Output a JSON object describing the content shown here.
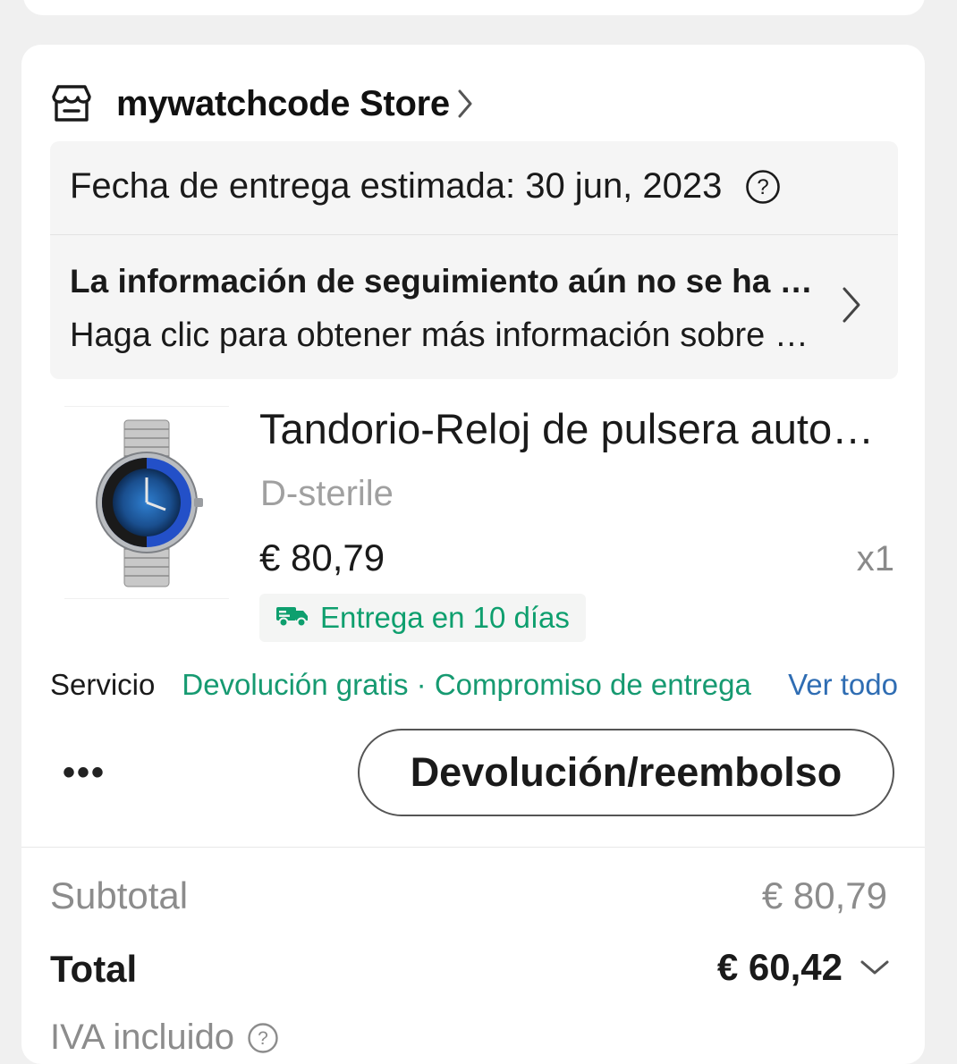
{
  "store": {
    "name": "mywatchcode Store",
    "icon": "store-icon"
  },
  "delivery": {
    "estimated_date": "Fecha de entrega estimada: 30 jun, 2023",
    "tracking_title": "La información de seguimiento aún no se ha actualizado",
    "tracking_subtitle": "Haga clic para obtener más información sobre el envío"
  },
  "product": {
    "title": "Tandorio-Reloj de pulsera automático",
    "variant": "D-sterile",
    "price": "€ 80,79",
    "quantity": "x1",
    "delivery_badge": "Entrega en 10 días"
  },
  "service": {
    "label": "Servicio",
    "value": "Devolución gratis · Compromiso de entrega",
    "link": "Ver todo"
  },
  "actions": {
    "more": "•••",
    "refund_button": "Devolución/reembolso"
  },
  "summary": {
    "subtotal_label": "Subtotal",
    "subtotal_value": "€ 80,79",
    "total_label": "Total",
    "total_value": "€ 60,42",
    "vat_label": "IVA incluido"
  },
  "colors": {
    "accent_green": "#169a71",
    "link_blue": "#2f6db3",
    "muted_gray": "#8c8c8c"
  }
}
